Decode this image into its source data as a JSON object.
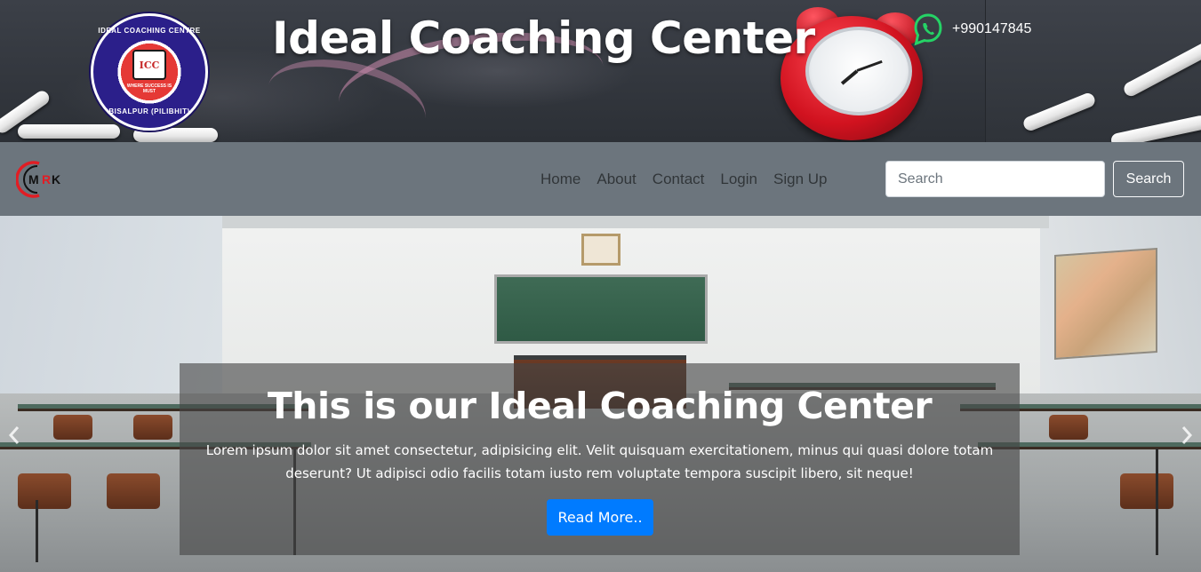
{
  "banner": {
    "title": "Ideal Coaching Center",
    "phone": "+990147845",
    "logo_text": {
      "top": "IDEAL COACHING CENTRE",
      "center": "ICC",
      "motto": "WHERE SUCCESS IS MUST",
      "bottom": "BISALPUR (PILIBHIT)"
    },
    "icons": [
      "logo-seal",
      "whatsapp-icon"
    ]
  },
  "navbar": {
    "brand_icon": "mrk-logo",
    "links": [
      {
        "label": "Home"
      },
      {
        "label": "About"
      },
      {
        "label": "Contact"
      },
      {
        "label": "Login"
      },
      {
        "label": "Sign Up"
      }
    ],
    "search": {
      "placeholder": "Search",
      "value": "",
      "button_label": "Search"
    }
  },
  "carousel": {
    "caption_title": "This is our Ideal Coaching Center",
    "caption_text": "Lorem ipsum dolor sit amet consectetur, adipisicing elit. Velit quisquam exercitationem, minus qui quasi dolore totam deserunt? Ut adipisci odio facilis totam iusto rem voluptate tempora suscipit libero, sit neque!",
    "button_label": "Read More..",
    "prev_icon": "chevron-left-icon",
    "next_icon": "chevron-right-icon"
  },
  "colors": {
    "navbar_bg": "#6c757d",
    "primary_button": "#007bff",
    "whatsapp_green": "#25d366"
  }
}
